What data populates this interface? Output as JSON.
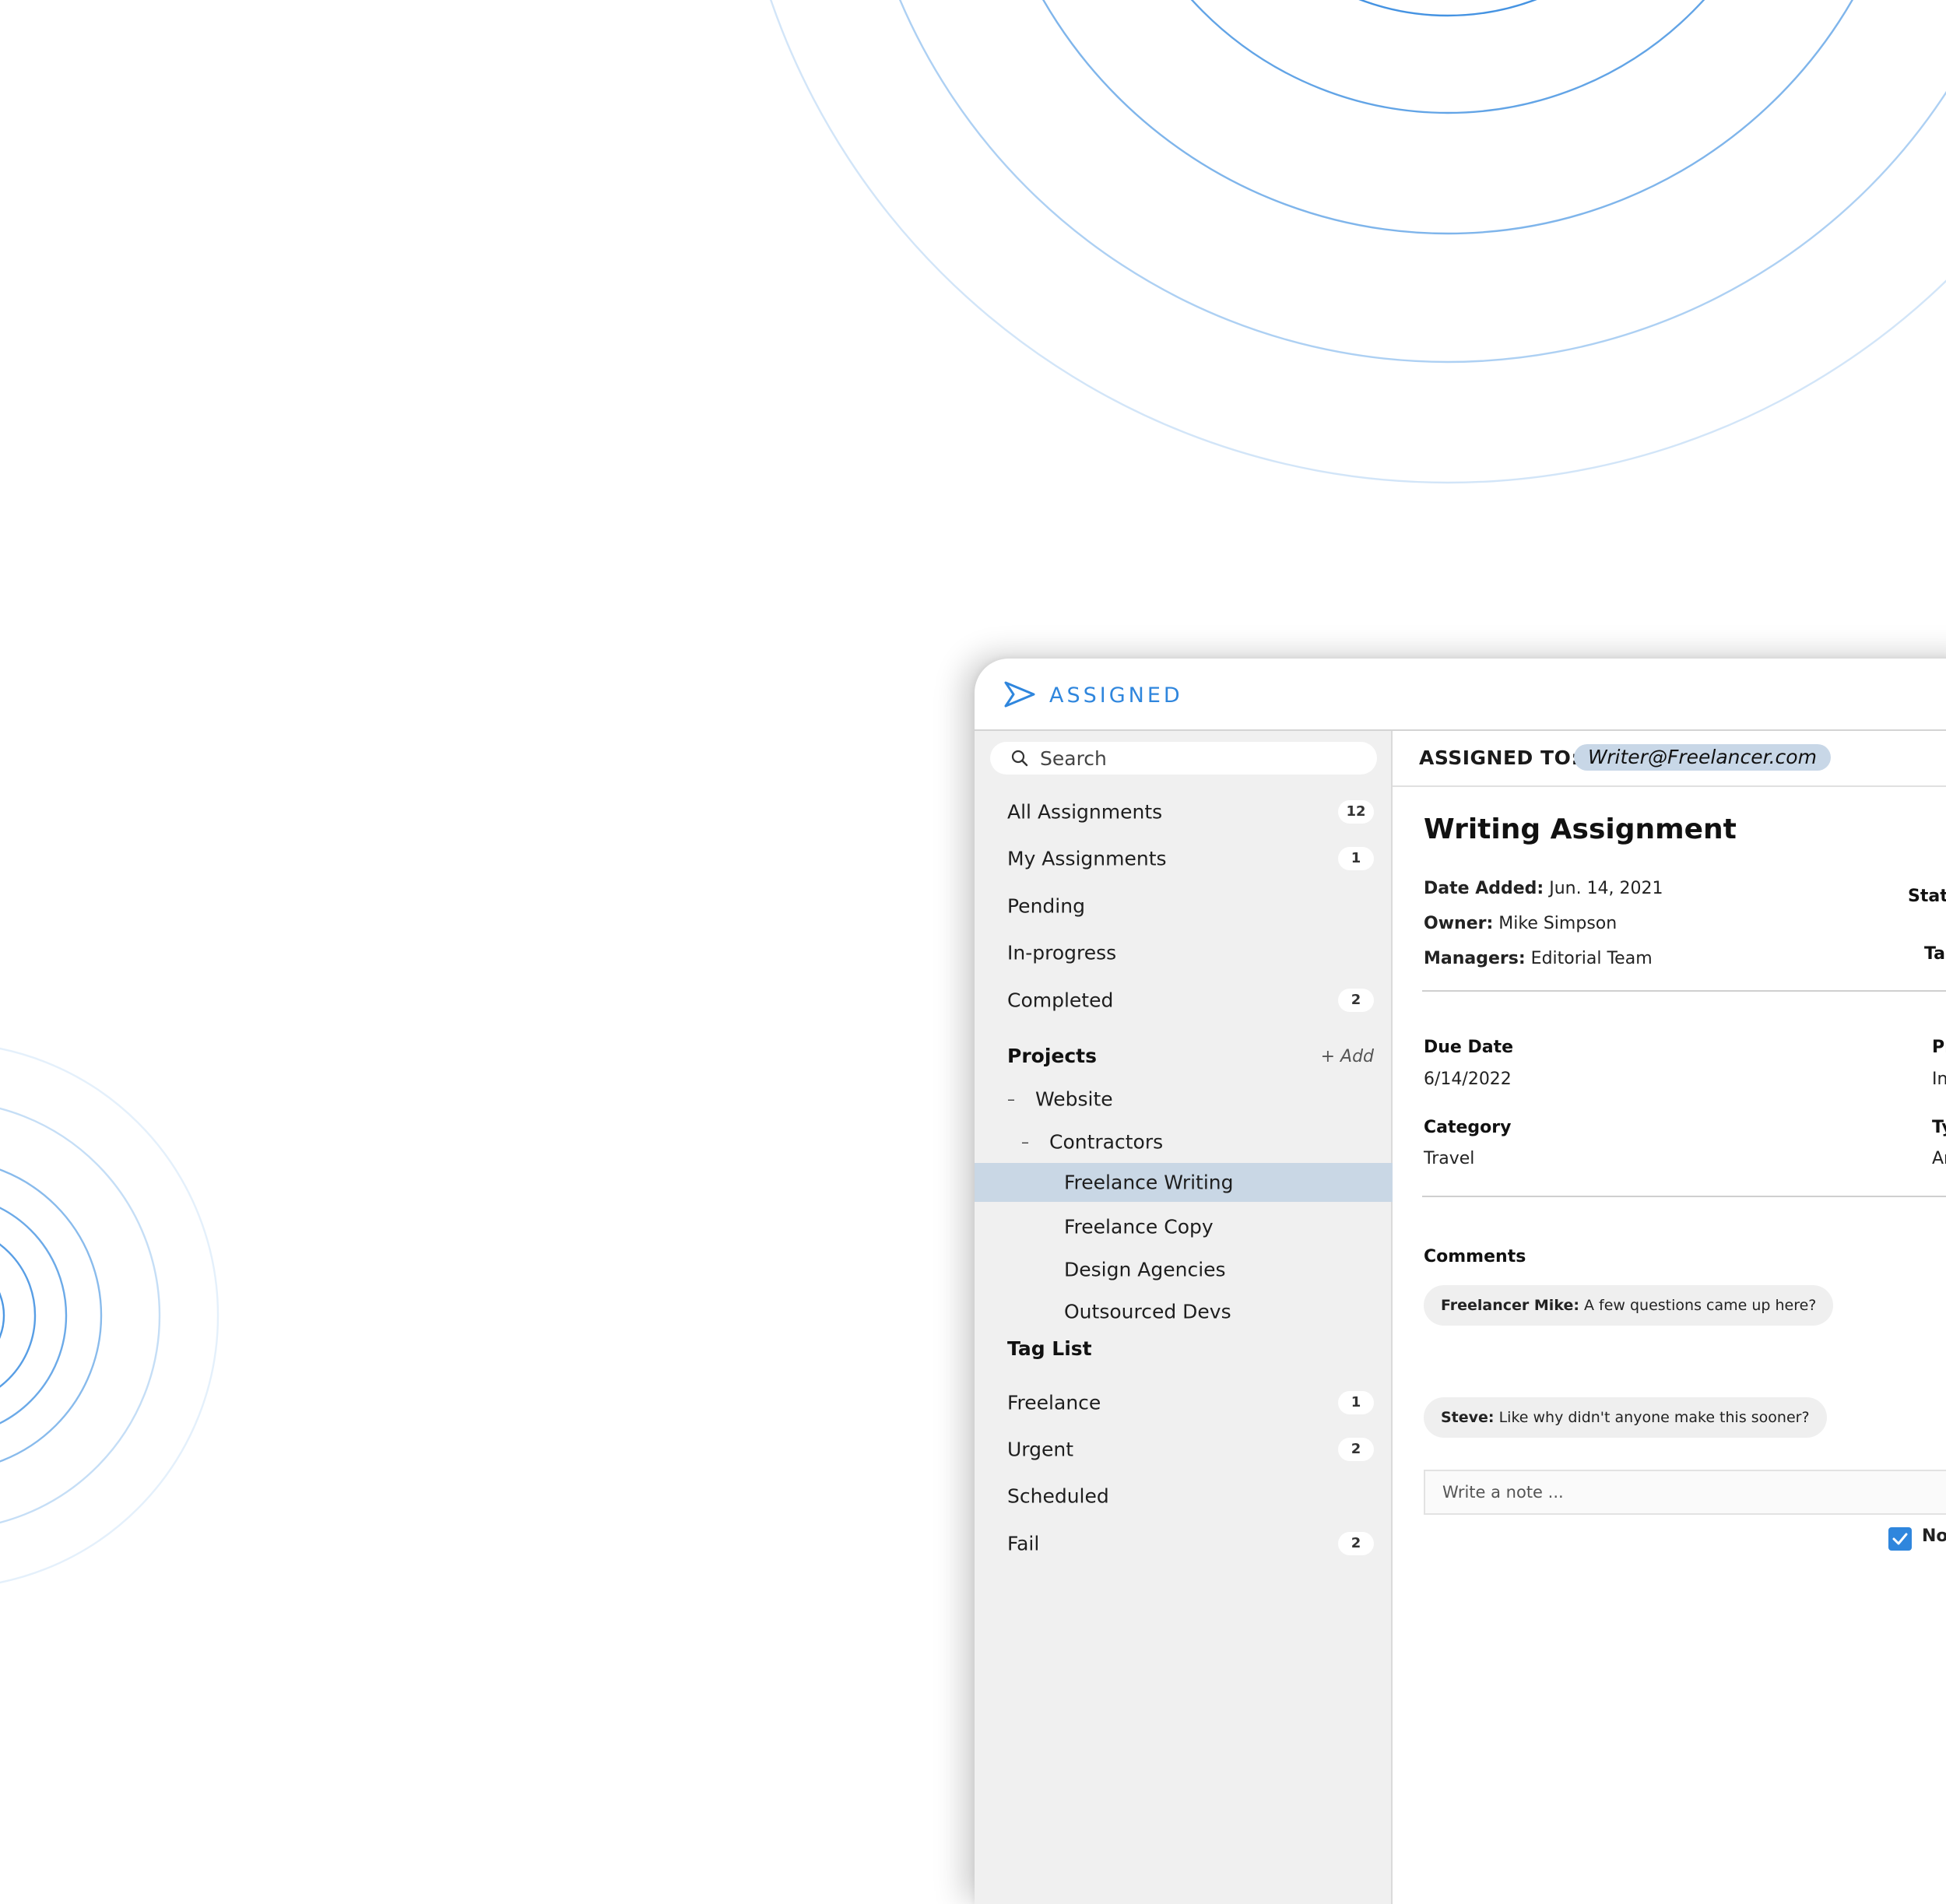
{
  "app": {
    "name": "ASSIGNED",
    "brand_color": "#2f86dd"
  },
  "search": {
    "placeholder": "Search"
  },
  "sidebar": {
    "views": [
      {
        "label": "All Assignments",
        "count": "12"
      },
      {
        "label": "My Assignments",
        "count": "1"
      },
      {
        "label": "Pending",
        "count": ""
      },
      {
        "label": "In-progress",
        "count": ""
      },
      {
        "label": "Completed",
        "count": "2"
      }
    ],
    "projects_heading": "Projects",
    "add_label": "+ Add",
    "projects": [
      {
        "label": "Website",
        "level": 1,
        "dash": "–"
      },
      {
        "label": "Contractors",
        "level": 2,
        "dash": "–"
      },
      {
        "label": "Freelance Writing",
        "level": 3,
        "selected": true
      },
      {
        "label": "Freelance Copy",
        "level": 3
      },
      {
        "label": "Design Agencies",
        "level": 3
      },
      {
        "label": "Outsourced Devs",
        "level": 3
      }
    ],
    "tags_heading": "Tag List",
    "tags": [
      {
        "label": "Freelance",
        "count": "1"
      },
      {
        "label": "Urgent",
        "count": "2"
      },
      {
        "label": "Scheduled",
        "count": ""
      },
      {
        "label": "Fail",
        "count": "2"
      }
    ]
  },
  "detail": {
    "assigned_to_label": "ASSIGNED TO:",
    "assignee": "Writer@Freelancer.com",
    "title": "Writing Assignment",
    "date_added_label": "Date Added:",
    "date_added": "Jun. 14, 2021",
    "owner_label": "Owner:",
    "owner": "Mike Simpson",
    "managers_label": "Managers:",
    "managers": "Editorial Team",
    "status_label_partial": "Statu",
    "tags_label_partial": "Ta",
    "due_date_label": "Due Date",
    "due_date": "6/14/2022",
    "priority_label_partial": "Pr",
    "priority_value_partial": "In",
    "category_label": "Category",
    "category": "Travel",
    "type_label_partial": "Ty",
    "type_value_partial": "Ar",
    "comments_heading": "Comments",
    "comments": [
      {
        "author": "Freelancer Mike:",
        "text": "A few questions came up here?"
      },
      {
        "author": "Steve:",
        "text": "Like why didn't anyone make this sooner?"
      }
    ],
    "note_placeholder": "Write a note ...",
    "notify_label_partial": "Noti",
    "notify_checked": true
  }
}
